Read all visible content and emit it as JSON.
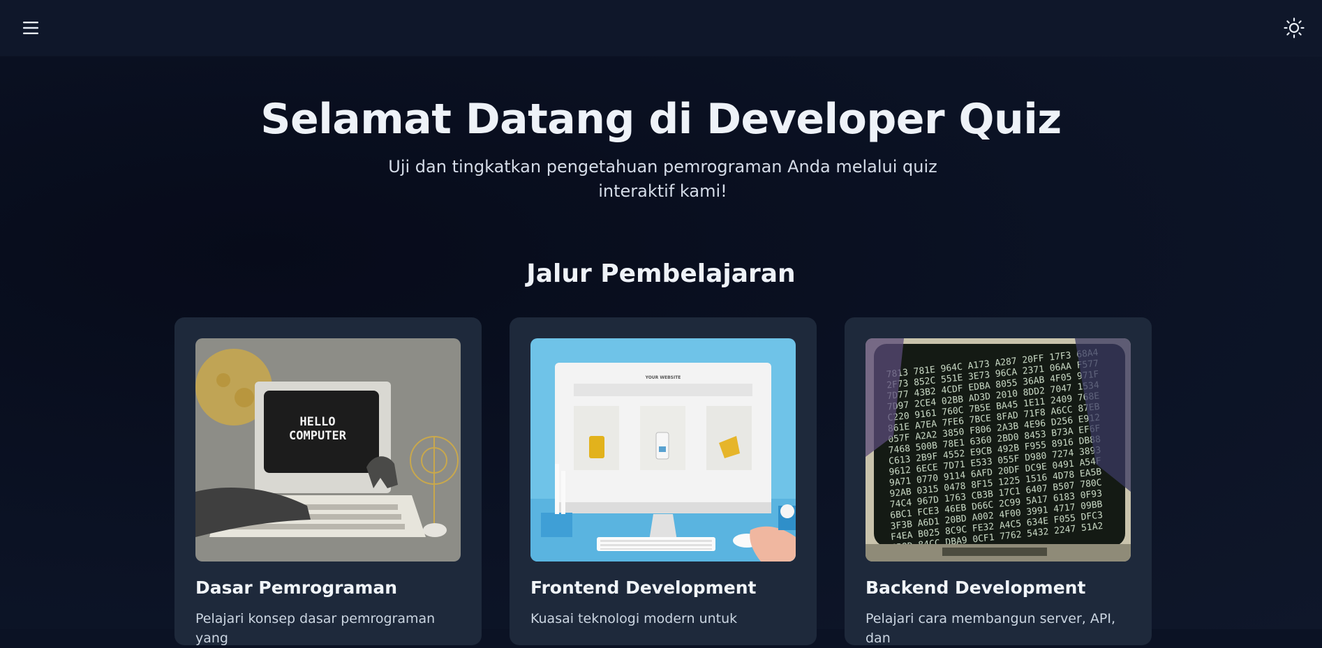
{
  "header": {
    "menu_icon": "hamburger-menu-icon",
    "theme_icon": "sun-icon"
  },
  "hero": {
    "title": "Selamat Datang di Developer Quiz",
    "subtitle": "Uji dan tingkatkan pengetahuan pemrograman Anda melalui quiz interaktif kami!"
  },
  "section": {
    "title": "Jalur Pembelajaran"
  },
  "cards": [
    {
      "title": "Dasar Pemrograman",
      "description": "Pelajari konsep dasar pemrograman yang",
      "image_text_1": "HELLO",
      "image_text_2": "COMPUTER"
    },
    {
      "title": "Frontend Development",
      "description": "Kuasai teknologi modern untuk",
      "image_text_1": "YOUR WEBSITE"
    },
    {
      "title": "Backend Development",
      "description": "Pelajari cara membangun server, API, dan"
    }
  ],
  "colors": {
    "background": "#0b1224",
    "topbar": "#0f172a",
    "card": "#1e293b",
    "text": "#eef2f8"
  }
}
